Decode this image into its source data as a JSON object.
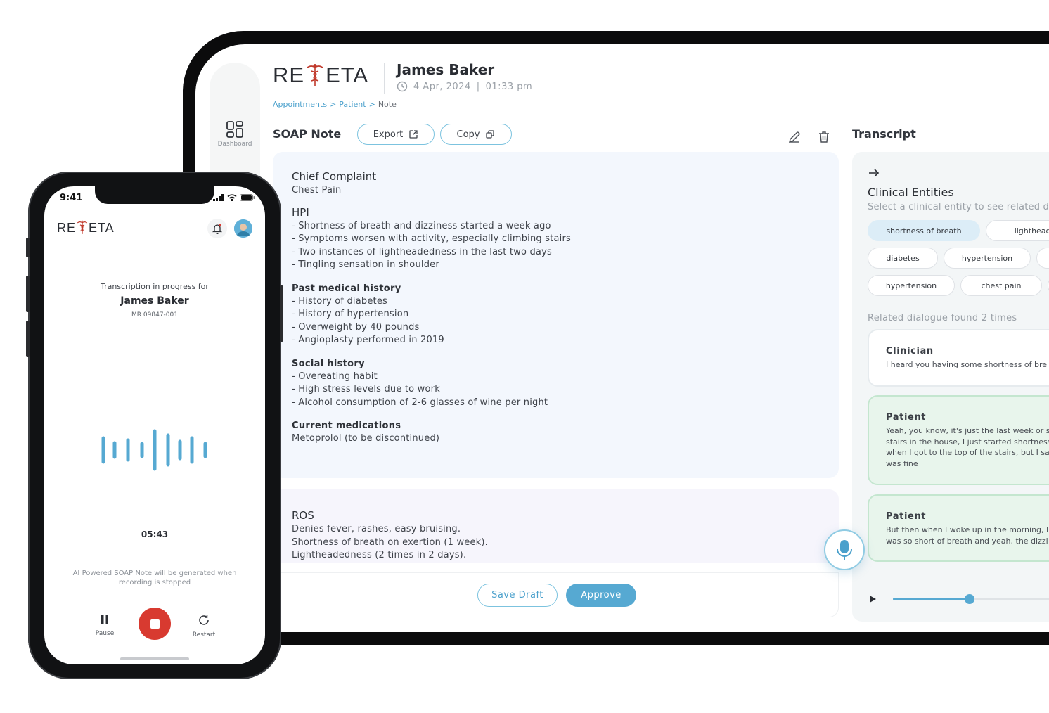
{
  "brand": {
    "logo_left": "RE",
    "logo_right": "ETA",
    "caduceus_color": "#c0392b"
  },
  "colors": {
    "accent": "#56a9d2",
    "stop": "#d83a30",
    "patient_bubble": "#e8f5ec"
  },
  "tablet": {
    "rail": {
      "dashboard_label": "Dashboard",
      "dashboard_icon": "dashboard-grid-icon"
    },
    "header": {
      "patient_name": "James Baker",
      "date": "4 Apr, 2024",
      "separator": "|",
      "time": "01:33 pm"
    },
    "breadcrumb": {
      "item1": "Appointments",
      "sep1": ">",
      "item2": "Patient",
      "sep2": ">",
      "current": "Note"
    },
    "soap": {
      "title": "SOAP Note",
      "export_label": "Export",
      "copy_label": "Copy",
      "chief_complaint": {
        "heading": "Chief Complaint",
        "lines": [
          "Chest Pain"
        ]
      },
      "hpi": {
        "heading": "HPI",
        "lines": [
          "- Shortness of breath and dizziness started a week ago",
          "- Symptoms worsen with activity, especially climbing stairs",
          "- Two instances of lightheadedness in the last two days",
          "- Tingling sensation in shoulder"
        ]
      },
      "past_history": {
        "heading": "Past medical history",
        "lines": [
          "- History of diabetes",
          "- History of hypertension",
          "- Overweight by 40 pounds",
          "- Angioplasty performed in 2019"
        ]
      },
      "social_history": {
        "heading": "Social history",
        "lines": [
          "- Overeating habit",
          "- High stress levels due to work",
          "- Alcohol consumption of 2-6 glasses of wine per night"
        ]
      },
      "medications": {
        "heading": "Current medications",
        "lines": [
          "Metoprolol (to be discontinued)"
        ]
      },
      "ros": {
        "heading": "ROS",
        "lines": [
          "Denies fever, rashes, easy bruising.",
          "Shortness of breath on exertion (1 week).",
          "Lightheadedness (2 times in 2 days)."
        ]
      },
      "save_draft_label": "Save Draft",
      "approve_label": "Approve"
    },
    "transcript": {
      "title": "Transcript",
      "entities_title": "Clinical Entities",
      "entities_subtitle": "Select a clinical entity to see related di",
      "chips": [
        "shortness of breath",
        "lightheade",
        "diabetes",
        "hypertension",
        "hypertension",
        "chest pain"
      ],
      "related_label": "Related dialogue found 2 times",
      "dialogue": [
        {
          "speaker": "Clinician",
          "lines": [
            "I heard you having some shortness of bre"
          ]
        },
        {
          "speaker": "Patient",
          "lines": [
            "Yeah, you know, it's just the last week or so",
            "stairs in the house, I just started shortness",
            "when I got to the top of the stairs, but I sa",
            "was fine"
          ]
        },
        {
          "speaker": "Patient",
          "lines": [
            "But then when I woke up in the morning, I",
            "was so short of breath and yeah, the dizzi"
          ]
        }
      ],
      "playback_progress": 0.35
    }
  },
  "phone": {
    "status_time": "9:41",
    "progress_label": "Transcription in progress for",
    "patient_name": "James Baker",
    "mr": "MR 09847-001",
    "timer": "05:43",
    "hint": "AI Powered SOAP Note will be generated when recording is stopped",
    "pause_label": "Pause",
    "restart_label": "Restart"
  }
}
